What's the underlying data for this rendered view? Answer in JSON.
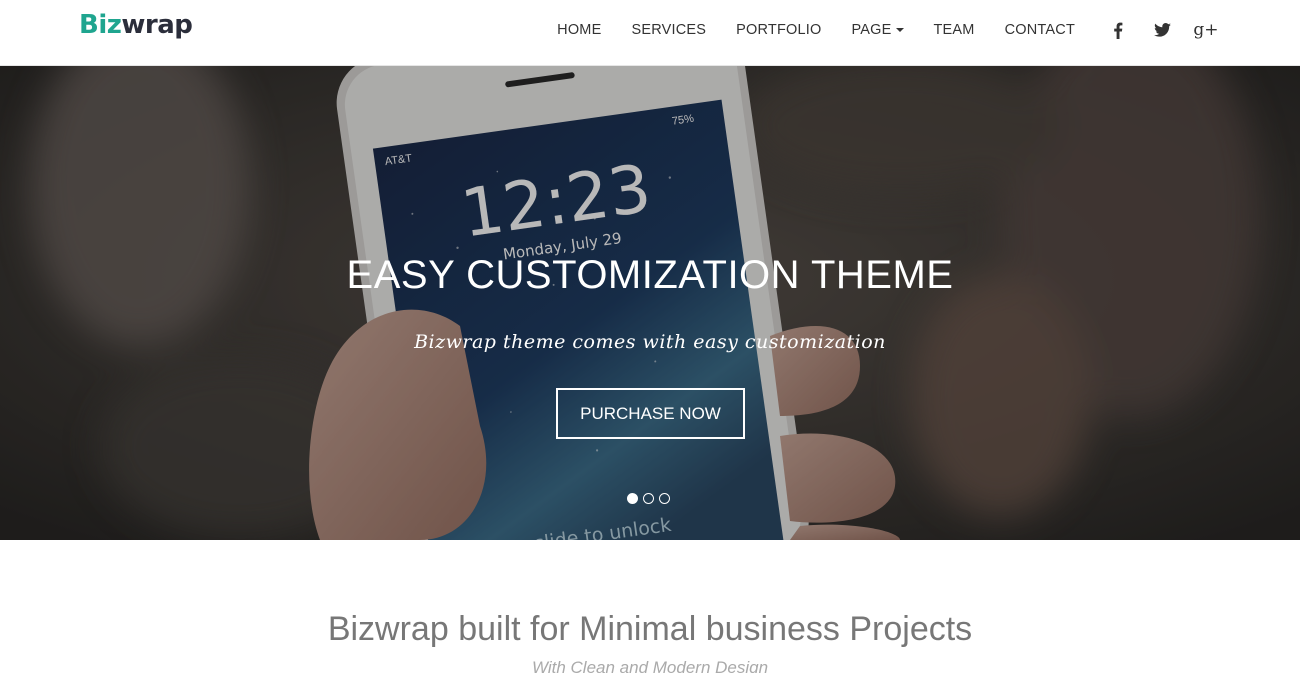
{
  "brand": {
    "part1": "Biz",
    "part2": "wrap",
    "color1": "#1fa58f",
    "color2": "#2b2e3b"
  },
  "nav": {
    "items": [
      {
        "label": "HOME"
      },
      {
        "label": "SERVICES"
      },
      {
        "label": "PORTFOLIO"
      },
      {
        "label": "PAGE",
        "dropdown": true
      },
      {
        "label": "TEAM"
      },
      {
        "label": "CONTACT"
      }
    ],
    "social": [
      "facebook-icon",
      "twitter-icon",
      "google-plus-icon"
    ],
    "gplus_glyph": "g+"
  },
  "hero": {
    "title": "EASY CUSTOMIZATION THEME",
    "subtitle": "Bizwrap theme comes with easy customization",
    "button_label": "PURCHASE NOW",
    "phone": {
      "carrier": "AT&T",
      "battery": "75%",
      "time": "12:23",
      "date": "Monday, July 29",
      "unlock_text": "slide to unlock"
    },
    "slides": {
      "count": 3,
      "active": 1
    }
  },
  "section": {
    "title": "Bizwrap built for Minimal business Projects",
    "subtitle": "With Clean and Modern Design"
  }
}
